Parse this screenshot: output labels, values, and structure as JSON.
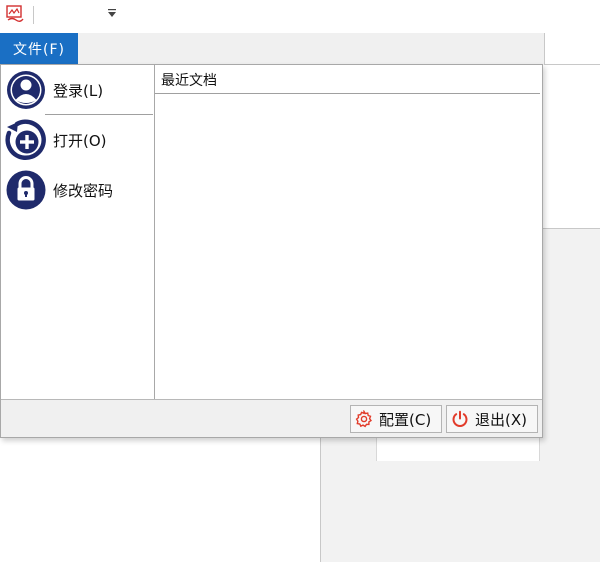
{
  "menubar": {
    "file_tab": "文件(F)"
  },
  "backstage": {
    "commands": [
      {
        "label": "登录(L)",
        "icon": "user-avatar-icon"
      },
      {
        "label": "打开(O)",
        "icon": "add-circle-icon"
      },
      {
        "label": "修改密码",
        "icon": "lock-icon"
      }
    ],
    "recent_title": "最近文档",
    "footer": {
      "config_label": "配置(C)",
      "exit_label": "退出(X)"
    }
  },
  "colors": {
    "file_tab_bg": "#1a6fc4",
    "icon_navy": "#1f2a6b",
    "icon_red": "#e23b2a"
  }
}
